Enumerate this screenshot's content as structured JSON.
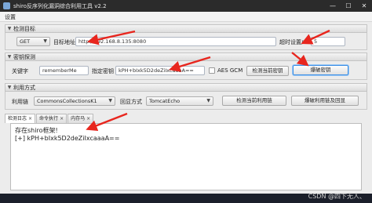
{
  "window": {
    "title": "shiro反序列化漏洞综合利用工具 v2.2",
    "controls": [
      "—",
      "☐",
      "✕"
    ]
  },
  "menu": {
    "settings": "设置"
  },
  "detect_target": {
    "header": "检测目标",
    "method": "GET",
    "url_label": "目标地址",
    "url_value": "http://192.168.8.135:8080",
    "timeout_label": "超时设置/s",
    "timeout_value": "5"
  },
  "key_detect": {
    "header": "密钥探测",
    "keyword_label": "关键字",
    "keyword_value": "rememberMe",
    "key_label": "指定密钥",
    "key_value": "kPH+bIxk5D2deZiIxcaaaA==",
    "aes_gcm_label": "AES GCM",
    "detect_key_button": "检测当前密钥",
    "bruteforce_key_button": "爆破密钥"
  },
  "exploit": {
    "header": "利用方式",
    "chain_label": "利用链",
    "chain_value": "CommonsCollectionsK1",
    "echo_label": "回显方式",
    "echo_value": "TomcatEcho",
    "detect_chain_button": "检测当前利用链",
    "bruteforce_chain_button": "爆破利用链及回显"
  },
  "tabs": [
    "检测日志",
    "命令执行",
    "内存马"
  ],
  "log": {
    "lines": [
      "存在shiro框架!",
      "[+] kPH+bIxk5D2deZiIxcaaaA=="
    ]
  },
  "watermark": "CSDN @四下无人、",
  "colors": {
    "arrow": "#e8261e",
    "focus": "#3a8ee6",
    "titlebar": "#2b2b2b"
  }
}
